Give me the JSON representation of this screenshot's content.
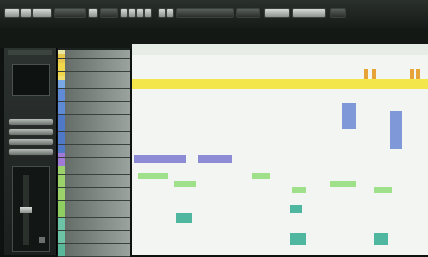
{
  "app": {
    "toolbar": {
      "buttons": [
        {
          "id": "b1",
          "label": ""
        },
        {
          "id": "b2",
          "label": ""
        },
        {
          "id": "b3",
          "label": ""
        }
      ],
      "transport_mode": "",
      "sync": ""
    },
    "info_row": [
      {
        "label": "",
        "value": ""
      }
    ],
    "inspector": {
      "buttons": [
        "",
        "",
        "",
        ""
      ],
      "texts": [
        "",
        "",
        "",
        ""
      ]
    },
    "tracks": [
      {
        "name": "",
        "color": "#e8e6a0"
      },
      {
        "name": "",
        "color": "#e8c84a"
      },
      {
        "name": "",
        "color": "#e8c84a"
      },
      {
        "name": "",
        "color": "#f0d84c"
      },
      {
        "name": "",
        "color": "#f0d84c"
      },
      {
        "name": "",
        "color": "#f0d84c"
      },
      {
        "name": "",
        "color": "#f0e070"
      },
      {
        "name": "",
        "color": "#7aa8e6"
      },
      {
        "name": "",
        "color": "#7aa8e6"
      },
      {
        "name": "",
        "color": "#5f8ad6"
      },
      {
        "name": "",
        "color": "#5f8ad6"
      },
      {
        "name": "",
        "color": "#5f8ad6"
      },
      {
        "name": "",
        "color": "#5f8ad6"
      },
      {
        "name": "",
        "color": "#5f8ad6"
      },
      {
        "name": "",
        "color": "#5f8ad6"
      },
      {
        "name": "",
        "color": "#4f78c6"
      },
      {
        "name": "",
        "color": "#4f78c6"
      },
      {
        "name": "",
        "color": "#4f78c6"
      },
      {
        "name": "",
        "color": "#4f78c6"
      },
      {
        "name": "",
        "color": "#4f78c6"
      },
      {
        "name": "",
        "color": "#4f78c6"
      },
      {
        "name": "",
        "color": "#4f78c6"
      },
      {
        "name": "",
        "color": "#4f78c6"
      },
      {
        "name": "",
        "color": "#4f78c6"
      },
      {
        "name": "",
        "color": "#a07ad6"
      },
      {
        "name": "",
        "color": "#a07ad6"
      },
      {
        "name": "",
        "color": "#a07ad6"
      },
      {
        "name": "",
        "color": "#9bd36a"
      },
      {
        "name": "",
        "color": "#9bd36a"
      },
      {
        "name": "",
        "color": "#9bd36a"
      },
      {
        "name": "",
        "color": "#9bd36a"
      },
      {
        "name": "",
        "color": "#9bd36a"
      },
      {
        "name": "",
        "color": "#9bd36a"
      },
      {
        "name": "",
        "color": "#9bd36a"
      },
      {
        "name": "",
        "color": "#9bd36a"
      },
      {
        "name": "",
        "color": "#8fcf62"
      },
      {
        "name": "",
        "color": "#8fcf62"
      },
      {
        "name": "",
        "color": "#8fcf62"
      },
      {
        "name": "",
        "color": "#8fcf62"
      },
      {
        "name": "",
        "color": "#6cc3a6"
      },
      {
        "name": "",
        "color": "#6cc3a6"
      },
      {
        "name": "",
        "color": "#6cc3a6"
      },
      {
        "name": "",
        "color": "#6cc3a6"
      },
      {
        "name": "",
        "color": "#6cc3a6"
      },
      {
        "name": "",
        "color": "#6cc3a6"
      },
      {
        "name": "",
        "color": "#5ab89a"
      },
      {
        "name": "",
        "color": "#5ab89a"
      },
      {
        "name": "",
        "color": "#5ab89a"
      }
    ],
    "colors": {
      "accent_yellow": "#f2e64a",
      "clip_orange": "#e8a23a",
      "clip_blue": "#7f98d8",
      "clip_purple": "#8d8ad6",
      "clip_green": "#9fe08a",
      "clip_teal": "#4fb7a0"
    }
  }
}
